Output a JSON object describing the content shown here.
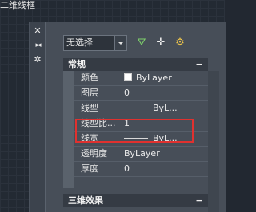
{
  "viewport": {
    "label": "二维线框"
  },
  "palette_strip": {
    "close_glyph": "✕",
    "pin_glyph": "▸◂",
    "settings_glyph": "✲"
  },
  "toolbar": {
    "selection_value": "无选择",
    "quick_select_glyph": "⛛",
    "select_objects_glyph": "✛",
    "toggle_pickadd_glyph": "⚙"
  },
  "sections": {
    "general": {
      "title": "常规",
      "toggle": "−"
    },
    "3d_effects": {
      "title": "三维效果",
      "toggle": "−"
    }
  },
  "properties": [
    {
      "label": "颜色",
      "value": "ByLayer",
      "kind": "color"
    },
    {
      "label": "图层",
      "value": "0",
      "kind": "text"
    },
    {
      "label": "线型",
      "value": "ByL...",
      "kind": "line"
    },
    {
      "label": "线型比...",
      "value": "1",
      "kind": "text"
    },
    {
      "label": "线宽",
      "value": "ByL...",
      "kind": "line"
    },
    {
      "label": "透明度",
      "value": "ByLayer",
      "kind": "text"
    },
    {
      "label": "厚度",
      "value": "0",
      "kind": "text"
    }
  ],
  "colors": {
    "highlight": "#e0312f",
    "panel_bg": "#474e58",
    "section_header_bg": "#353b44"
  }
}
